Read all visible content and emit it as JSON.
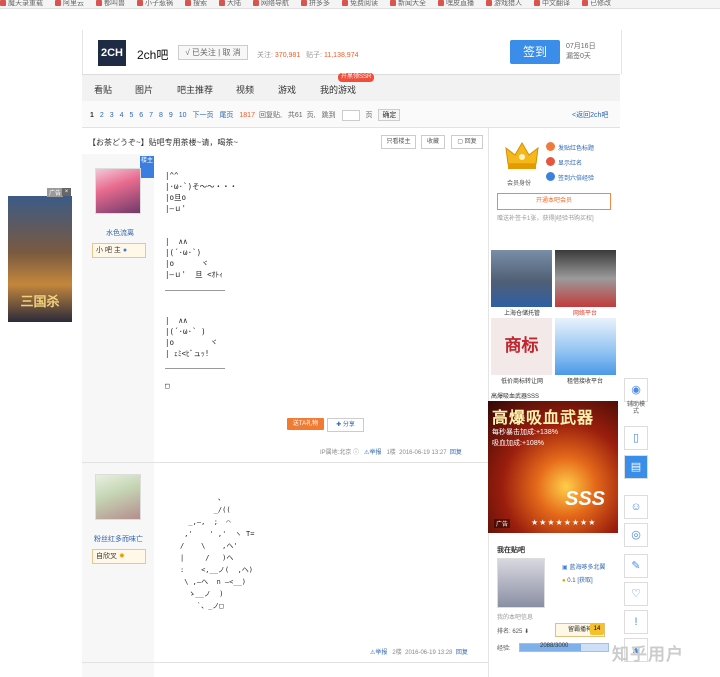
{
  "favorites_bar": [
    "魔天录重载",
    "阿里云",
    "都叫兽",
    "小子惹祸",
    "搜索",
    "大陆",
    "网络导航",
    "拼多多",
    "免费阅读",
    "新闻大全",
    "嘿皮直播",
    "游戏猎人",
    "中文翻译",
    "已修改"
  ],
  "forum": {
    "logo": "2CH",
    "name": "2ch吧",
    "follow_label": "√ 已关注  |  取 消",
    "stats_follow_label": "关注:",
    "stats_follow_value": "370,981",
    "stats_posts_label": "贴子:",
    "stats_posts_value": "11,138,974",
    "signin_label": "签到",
    "sign_date": "07月16日",
    "sign_status": "漏签0天"
  },
  "nav": {
    "items": [
      "看贴",
      "图片",
      "吧主推荐",
      "视频",
      "游戏",
      "我的游戏"
    ],
    "badge": "开黑领SSR"
  },
  "pagination": {
    "pages": [
      "1",
      "2",
      "3",
      "4",
      "5",
      "6",
      "7",
      "8",
      "9",
      "10"
    ],
    "next": "下一页",
    "last": "尾页",
    "reply_count": "1817",
    "reply_label": "回复贴,",
    "page_count": "共61",
    "page_label": "页,",
    "jump_label": "跳到",
    "page_unit": "页",
    "jump_btn": "确定",
    "back_link": "<返回2ch吧"
  },
  "thread": {
    "title": "【お茶どうぞ~】贴吧专用茶楼~请，喝茶~",
    "btn_only_op": "只看楼主",
    "btn_collect": "收藏",
    "btn_reply": "回复"
  },
  "post1": {
    "lz_tag": "楼主",
    "author": "水色流离",
    "level": "小 吧 主",
    "content_a": "|^^\n|·ω·`)そ～～・・・\n|o旦o\n|―ｕ'",
    "content_b": "|  ∧∧\n|(´·ω·`)\n|o      ヾ\n|―ｕ'  旦 <ｵﾄｨ",
    "content_c": "|  ∧∧\n|(´·ω·` )\n|o        ヾ\n| ｪﾐ<ﾋﾞュｯ!",
    "content_d": "□",
    "share_orange": "送TA礼物",
    "share": "分享",
    "ip": "IP属地:北京",
    "report": "举报",
    "floor": "1楼",
    "time": "2016-06-19 13:27",
    "reply": "回复"
  },
  "post2": {
    "author": "粉丝红多而味亡",
    "level": "自欣叉",
    "art": "         、\n        _/((\n  _,―,  ;  ⌒\n ,'    ' ,'  ヽ T=\n/    \\    ,ヘ'\n|     /   )ヘ\n:    <,__ノ(  ,ヘ)\n \\ ,―ヘ  ∩ ―<__)\n  ゝ__ノ  )\n    `、_ノ□",
    "report": "举报",
    "floor": "2楼",
    "time": "2016-06-19 13:28",
    "reply": "回复"
  },
  "left_ad": {
    "label": "广告",
    "close": "×",
    "logo": "三国杀"
  },
  "sidebar": {
    "crown_label": "会员身份",
    "privileges": [
      "发贴红色标题",
      "显示红名",
      "签到六倍经验"
    ],
    "open_member": "开通本吧会员",
    "member_note": "赠送补签卡1张，获得[经验书购买权]",
    "tiles": [
      "上海仓储托管",
      "网络平台",
      "低价商标转让网",
      "租借接收平台"
    ],
    "sss_label": "高爆吸血武器SSS",
    "sss_title": "高爆吸血武器",
    "sss_line1": "每秒暴击加成:+138%",
    "sss_line2": "吸血加成:+108%",
    "sss_big": "SSS",
    "sss_ad_tag": "广告",
    "sss_stars": "★★★★★★★★",
    "in_forum": "我在贴吧",
    "user_name": "蓝海哆多北翼",
    "user_points": "0.1",
    "user_get": "[获取]",
    "user_level_info": "我的本吧信息",
    "rank_label": "排名:",
    "rank_value": "625",
    "upgrade": "留霸播神",
    "level_num": "14",
    "exp_label": "经验:",
    "exp_value": "2088/3000",
    "exp_progress": 0.69
  },
  "right_tools": {
    "help_label": "辅助模式"
  },
  "watermark": "知乎用户"
}
